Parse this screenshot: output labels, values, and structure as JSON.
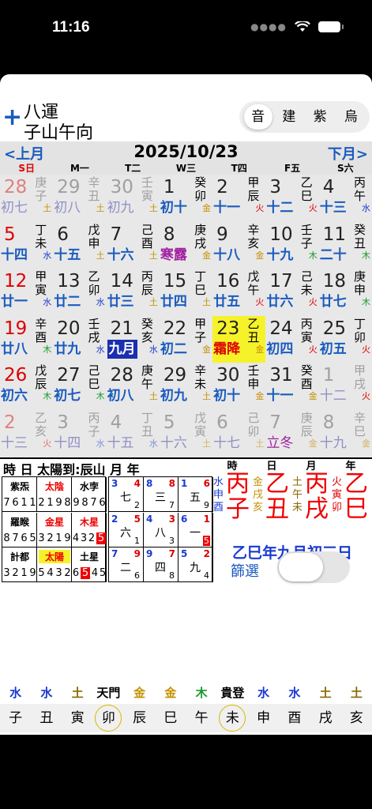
{
  "status": {
    "time": "11:16"
  },
  "header": {
    "line1": "八運",
    "line2": "子山午向",
    "plus_icon": "+",
    "segments": [
      {
        "label": "音",
        "active": true
      },
      {
        "label": "建",
        "active": false
      },
      {
        "label": "紫",
        "active": false
      },
      {
        "label": "烏",
        "active": false
      }
    ]
  },
  "calendar": {
    "prev": "<上月",
    "next": "下月>",
    "title": "2025/10/23",
    "weekdays": [
      {
        "label": "S日",
        "sun": true
      },
      {
        "label": "M一"
      },
      {
        "label": "T二"
      },
      {
        "label": "W三"
      },
      {
        "label": "T四"
      },
      {
        "label": "F五"
      },
      {
        "label": "S六"
      }
    ],
    "weeks": [
      [
        {
          "n": "28",
          "l": "初七",
          "g1": "庚",
          "g2": "子",
          "e": "土",
          "ec": "#c49000",
          "o": true
        },
        {
          "n": "29",
          "l": "初八",
          "g1": "辛",
          "g2": "丑",
          "e": "土",
          "ec": "#c49000",
          "o": true
        },
        {
          "n": "30",
          "l": "初九",
          "g1": "壬",
          "g2": "寅",
          "e": "土",
          "ec": "#c49000",
          "o": true
        },
        {
          "n": "1",
          "l": "初十",
          "g1": "癸",
          "g2": "卯",
          "e": "金",
          "ec": "#c49000"
        },
        {
          "n": "2",
          "l": "十一",
          "g1": "甲",
          "g2": "辰",
          "e": "火",
          "ec": "#e00000"
        },
        {
          "n": "3",
          "l": "十二",
          "g1": "乙",
          "g2": "巳",
          "e": "火",
          "ec": "#e00000"
        },
        {
          "n": "4",
          "l": "十三",
          "g1": "丙",
          "g2": "午",
          "e": "水",
          "ec": "#1a3ad0"
        }
      ],
      [
        {
          "n": "5",
          "l": "十四",
          "g1": "丁",
          "g2": "未",
          "e": "水",
          "ec": "#1a3ad0"
        },
        {
          "n": "6",
          "l": "十五",
          "g1": "戊",
          "g2": "申",
          "e": "土",
          "ec": "#c49000"
        },
        {
          "n": "7",
          "l": "十六",
          "g1": "己",
          "g2": "酉",
          "e": "土",
          "ec": "#c49000"
        },
        {
          "n": "8",
          "l": "寒露",
          "term": true,
          "g1": "庚",
          "g2": "戌",
          "e": "金",
          "ec": "#c49000"
        },
        {
          "n": "9",
          "l": "十八",
          "g1": "辛",
          "g2": "亥",
          "e": "金",
          "ec": "#c49000"
        },
        {
          "n": "10",
          "l": "十九",
          "g1": "壬",
          "g2": "子",
          "e": "木",
          "ec": "#1a9a2a"
        },
        {
          "n": "11",
          "l": "二十",
          "g1": "癸",
          "g2": "丑",
          "e": "木",
          "ec": "#1a9a2a"
        }
      ],
      [
        {
          "n": "12",
          "l": "廿一",
          "g1": "甲",
          "g2": "寅",
          "e": "水",
          "ec": "#1a3ad0"
        },
        {
          "n": "13",
          "l": "廿二",
          "g1": "乙",
          "g2": "卯",
          "e": "水",
          "ec": "#1a3ad0"
        },
        {
          "n": "14",
          "l": "廿三",
          "g1": "丙",
          "g2": "辰",
          "e": "土",
          "ec": "#c49000"
        },
        {
          "n": "15",
          "l": "廿四",
          "g1": "丁",
          "g2": "巳",
          "e": "土",
          "ec": "#c49000"
        },
        {
          "n": "16",
          "l": "廿五",
          "g1": "戊",
          "g2": "午",
          "e": "火",
          "ec": "#e00000"
        },
        {
          "n": "17",
          "l": "廿六",
          "g1": "己",
          "g2": "未",
          "e": "火",
          "ec": "#e00000"
        },
        {
          "n": "18",
          "l": "廿七",
          "g1": "庚",
          "g2": "申",
          "e": "木",
          "ec": "#1a9a2a"
        }
      ],
      [
        {
          "n": "19",
          "l": "廿八",
          "g1": "辛",
          "g2": "酉",
          "e": "木",
          "ec": "#1a9a2a"
        },
        {
          "n": "20",
          "l": "廿九",
          "g1": "壬",
          "g2": "戌",
          "e": "水",
          "ec": "#1a3ad0"
        },
        {
          "n": "21",
          "l": "九月",
          "boxed": true,
          "g1": "癸",
          "g2": "亥",
          "e": "水",
          "ec": "#1a3ad0"
        },
        {
          "n": "22",
          "l": "初二",
          "g1": "甲",
          "g2": "子",
          "e": "金",
          "ec": "#c49000"
        },
        {
          "n": "23",
          "l": "霜降",
          "red": true,
          "today": true,
          "g1": "乙",
          "g2": "丑",
          "e": "金",
          "ec": "#c49000"
        },
        {
          "n": "24",
          "l": "初四",
          "g1": "丙",
          "g2": "寅",
          "e": "火",
          "ec": "#e00000"
        },
        {
          "n": "25",
          "l": "初五",
          "g1": "丁",
          "g2": "卯",
          "e": "火",
          "ec": "#e00000"
        }
      ],
      [
        {
          "n": "26",
          "l": "初六",
          "g1": "戊",
          "g2": "辰",
          "e": "木",
          "ec": "#1a9a2a"
        },
        {
          "n": "27",
          "l": "初七",
          "g1": "己",
          "g2": "巳",
          "e": "木",
          "ec": "#1a9a2a"
        },
        {
          "n": "28",
          "l": "初八",
          "g1": "庚",
          "g2": "午",
          "e": "土",
          "ec": "#c49000"
        },
        {
          "n": "29",
          "l": "初九",
          "g1": "辛",
          "g2": "未",
          "e": "土",
          "ec": "#c49000"
        },
        {
          "n": "30",
          "l": "初十",
          "g1": "壬",
          "g2": "申",
          "e": "金",
          "ec": "#c49000"
        },
        {
          "n": "31",
          "l": "十一",
          "g1": "癸",
          "g2": "酉",
          "e": "金",
          "ec": "#c49000"
        },
        {
          "n": "1",
          "l": "十二",
          "g1": "甲",
          "g2": "戌",
          "e": "火",
          "ec": "#e00000",
          "o": true
        }
      ],
      [
        {
          "n": "2",
          "l": "十三",
          "g1": "乙",
          "g2": "亥",
          "e": "火",
          "ec": "#e07070",
          "o": true
        },
        {
          "n": "3",
          "l": "十四",
          "g1": "丙",
          "g2": "子",
          "e": "水",
          "ec": "#8090d8",
          "o": true
        },
        {
          "n": "4",
          "l": "十五",
          "g1": "丁",
          "g2": "丑",
          "e": "水",
          "ec": "#8090d8",
          "o": true
        },
        {
          "n": "5",
          "l": "十六",
          "g1": "戊",
          "g2": "寅",
          "e": "土",
          "ec": "#d4b060",
          "o": true
        },
        {
          "n": "6",
          "l": "十七",
          "g1": "己",
          "g2": "卯",
          "e": "土",
          "ec": "#d4b060",
          "o": true
        },
        {
          "n": "7",
          "l": "立冬",
          "term": true,
          "g1": "庚",
          "g2": "辰",
          "e": "金",
          "ec": "#d4b060",
          "o": true
        },
        {
          "n": "8",
          "l": "十九",
          "g1": "辛",
          "g2": "巳",
          "e": "金",
          "ec": "#d4b060",
          "o": true
        }
      ]
    ]
  },
  "lower": {
    "header": "時 日   太陽到:辰山   月 年",
    "stars": [
      {
        "name": "紫炁",
        "vals": [
          "7",
          "6",
          "1",
          "1"
        ]
      },
      {
        "name": "太陰",
        "red": true,
        "vals": [
          "2",
          "1",
          "9",
          "8"
        ]
      },
      {
        "name": "水孛",
        "vals": [
          "9",
          "8",
          "7",
          "6"
        ]
      },
      {
        "name": "羅睺",
        "vals": [
          "8",
          "7",
          "6",
          "5"
        ]
      },
      {
        "name": "金星",
        "red": true,
        "vals": [
          "3",
          "2",
          "1",
          "9"
        ]
      },
      {
        "name": "木星",
        "red": true,
        "vals": [
          "4",
          "3",
          "2",
          "5"
        ],
        "rv": 3
      },
      {
        "name": "計都",
        "vals": [
          "3",
          "2",
          "1",
          "9"
        ]
      },
      {
        "name": "太陽",
        "red": true,
        "hl": true,
        "vals": [
          "5",
          "4",
          "3",
          "2"
        ]
      },
      {
        "name": "土星",
        "vals": [
          "6",
          "5",
          "4",
          "5"
        ],
        "rv": 1
      }
    ],
    "flying": [
      {
        "a": "3",
        "b": "4",
        "c": "七",
        "d": "2"
      },
      {
        "a": "8",
        "b": "8",
        "c": "三",
        "d": "7"
      },
      {
        "a": "1",
        "b": "6",
        "c": "五",
        "d": "9"
      },
      {
        "a": "2",
        "b": "5",
        "c": "六",
        "d": "1"
      },
      {
        "a": "4",
        "b": "3",
        "c": "八",
        "d": "3"
      },
      {
        "a": "6",
        "b": "1",
        "c": "一",
        "d": "5",
        "dr": true
      },
      {
        "a": "7",
        "b": "9",
        "c": "二",
        "d": "6"
      },
      {
        "a": "9",
        "b": "7",
        "c": "四",
        "d": "8"
      },
      {
        "a": "5",
        "b": "2",
        "c": "九",
        "d": "4"
      }
    ],
    "pillars": [
      {
        "title": "時",
        "gan": "丙",
        "zhi": "子",
        "side": "水申酉",
        "sc": "#1a3ad0"
      },
      {
        "title": "日",
        "gan": "乙",
        "zhi": "丑",
        "side": "金戌亥",
        "sc": "#c49000"
      },
      {
        "title": "月",
        "gan": "丙",
        "zhi": "戌",
        "side": "土午未",
        "sc": "#8a6a00"
      },
      {
        "title": "年",
        "gan": "乙",
        "zhi": "巳",
        "side": "火寅卯",
        "sc": "#e00000"
      }
    ],
    "lunar_date": "乙巳年九月初三日",
    "filter": "篩選"
  },
  "bottom": {
    "labels": [
      {
        "t": "水",
        "c": "#1a3ad0"
      },
      {
        "t": "水",
        "c": "#1a3ad0"
      },
      {
        "t": "土",
        "c": "#8a6a00"
      },
      {
        "t": "天門",
        "c": "#000"
      },
      {
        "t": "金",
        "c": "#c49000"
      },
      {
        "t": "金",
        "c": "#c49000"
      },
      {
        "t": "木",
        "c": "#1a9a2a"
      },
      {
        "t": "貴登",
        "c": "#000"
      },
      {
        "t": "水",
        "c": "#1a3ad0"
      },
      {
        "t": "水",
        "c": "#1a3ad0"
      },
      {
        "t": "土",
        "c": "#8a6a00"
      },
      {
        "t": "土",
        "c": "#8a6a00"
      }
    ],
    "branches": [
      {
        "t": "子"
      },
      {
        "t": "丑"
      },
      {
        "t": "寅"
      },
      {
        "t": "卯",
        "c": true
      },
      {
        "t": "辰"
      },
      {
        "t": "巳"
      },
      {
        "t": "午"
      },
      {
        "t": "未",
        "c": true
      },
      {
        "t": "申"
      },
      {
        "t": "酉"
      },
      {
        "t": "戌"
      },
      {
        "t": "亥"
      }
    ]
  }
}
